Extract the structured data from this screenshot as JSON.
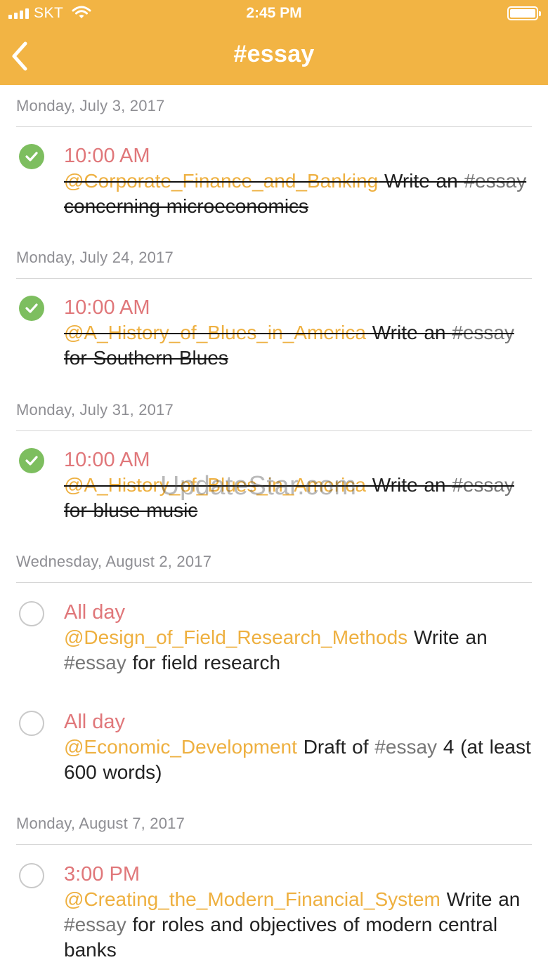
{
  "status_bar": {
    "carrier": "SKT",
    "time": "2:45 PM"
  },
  "nav": {
    "title": "#essay"
  },
  "sections": [
    {
      "date": "Monday, July 3, 2017",
      "tasks": [
        {
          "time": "10:00 AM",
          "completed": true,
          "project": "@Corporate_Finance_and_Banking",
          "before_tag": " Write an ",
          "tag": "#essay",
          "after_tag": " concerning microeconomics"
        }
      ]
    },
    {
      "date": "Monday, July 24, 2017",
      "tasks": [
        {
          "time": "10:00 AM",
          "completed": true,
          "project": "@A_History_of_Blues_in_America",
          "before_tag": " Write an ",
          "tag": "#essay",
          "after_tag": " for Southern Blues"
        }
      ]
    },
    {
      "date": "Monday, July 31, 2017",
      "tasks": [
        {
          "time": "10:00 AM",
          "completed": true,
          "project": "@A_History_of_Blues_in_America",
          "before_tag": " Write an ",
          "tag": "#essay",
          "after_tag": " for bluse music"
        }
      ]
    },
    {
      "date": "Wednesday, August 2, 2017",
      "tasks": [
        {
          "time": "All day",
          "completed": false,
          "project": "@Design_of_Field_Research_Methods",
          "before_tag": "  Write an ",
          "tag": "#essay",
          "after_tag": " for field research"
        },
        {
          "time": "All day",
          "completed": false,
          "project": "@Economic_Development",
          "before_tag": "  Draft of ",
          "tag": "#essay",
          "after_tag": " 4 (at least 600 words)"
        }
      ]
    },
    {
      "date": "Monday, August 7, 2017",
      "tasks": [
        {
          "time": "3:00 PM",
          "completed": false,
          "project": "@Creating_the_Modern_Financial_System",
          "before_tag": "  Write an  ",
          "tag": "#essay",
          "after_tag": " for roles and objectives of modern central banks"
        }
      ]
    }
  ],
  "watermark": "UpdateStar.com"
}
